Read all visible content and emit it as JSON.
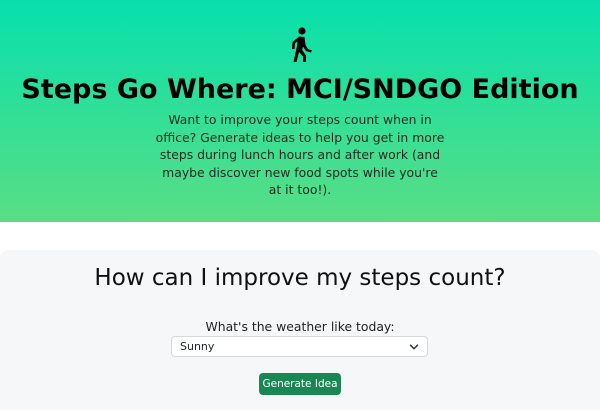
{
  "hero": {
    "icon": "person-walking-icon",
    "title": "Steps Go Where: MCI/SNDGO Edition",
    "description": "Want to improve your steps count when in office? Generate ideas to help you get in more steps during lunch hours and after work (and maybe discover new food spots while you're at it too!).",
    "gradient_top": "#07e0ad",
    "gradient_bottom": "#5ade84"
  },
  "form": {
    "question": "How can I improve my steps count?",
    "weather_label": "What's the weather like today:",
    "weather_selected": "Sunny",
    "submit_label": "Generate Idea",
    "submit_color": "#198754"
  }
}
